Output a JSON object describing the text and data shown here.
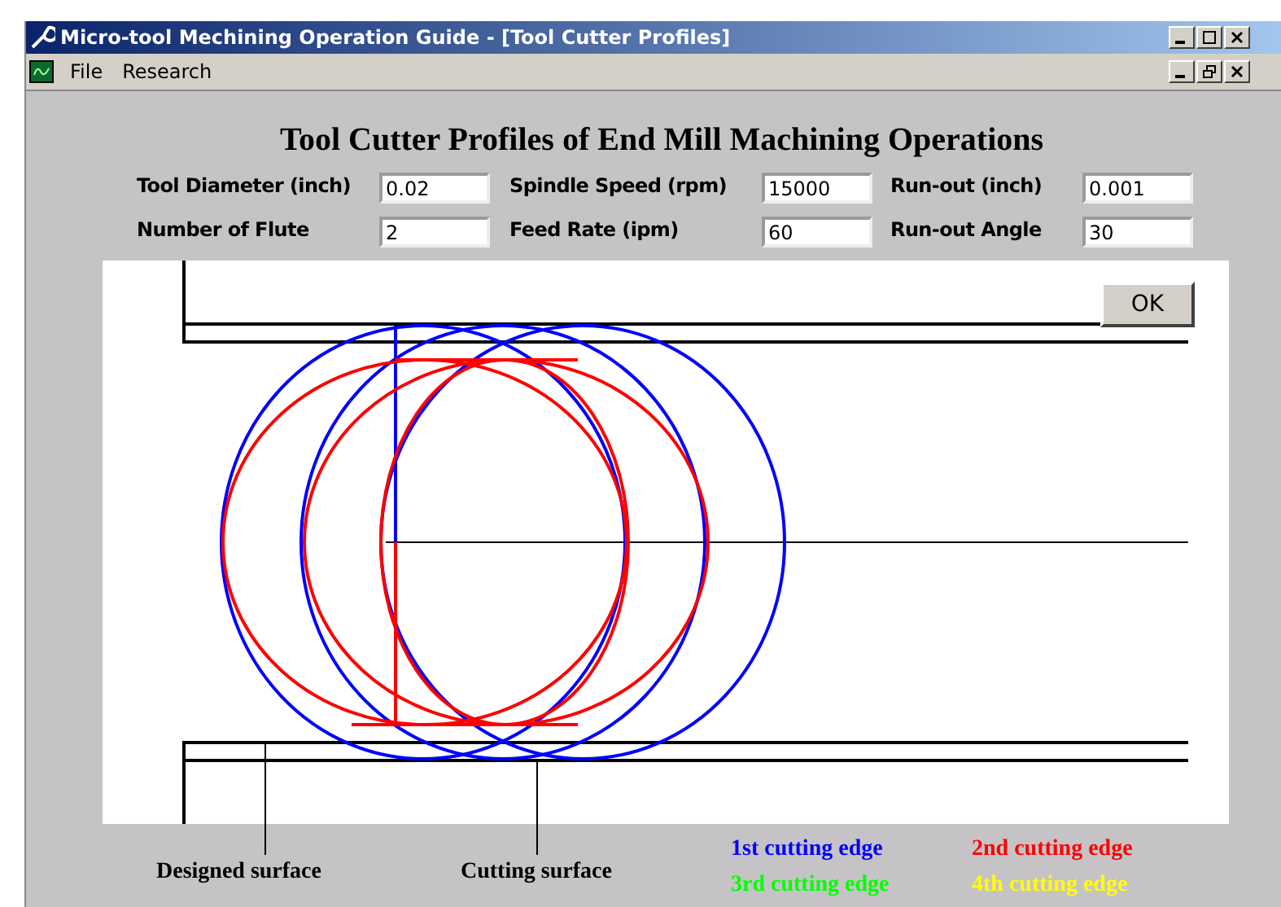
{
  "window": {
    "title": "Micro-tool Mechining Operation Guide - [Tool Cutter Profiles]"
  },
  "menu": [
    "File",
    "Research"
  ],
  "heading": "Tool Cutter Profiles of End Mill Machining Operations",
  "fields": [
    {
      "label": "Tool Diameter (inch)",
      "value": "0.02"
    },
    {
      "label": "Spindle Speed (rpm)",
      "value": "15000"
    },
    {
      "label": "Run-out (inch)",
      "value": "0.001"
    },
    {
      "label": "Number of Flute",
      "value": "2"
    },
    {
      "label": "Feed Rate (ipm)",
      "value": "60"
    },
    {
      "label": "Run-out Angle",
      "value": "30"
    }
  ],
  "ok_button": "OK",
  "surface_labels": [
    "Designed surface",
    "Cutting surface"
  ],
  "legend": [
    {
      "label": "1st cutting edge",
      "color": "#0000ff"
    },
    {
      "label": "2nd cutting edge",
      "color": "#ff0000"
    },
    {
      "label": "3rd cutting edge",
      "color": "#00ff00"
    },
    {
      "label": "4th cutting edge",
      "color": "#ffff00"
    }
  ]
}
